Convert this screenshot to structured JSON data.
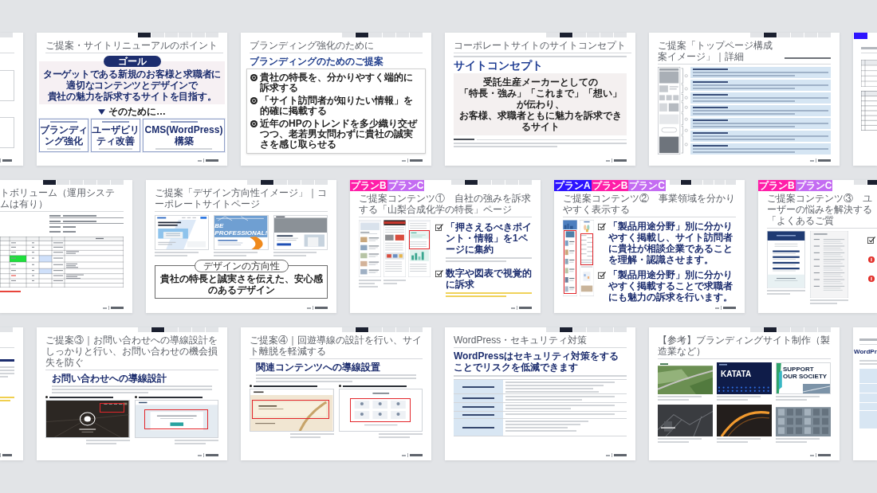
{
  "rows": [
    {
      "slides": [
        {
          "kind": "edge_outline",
          "nav_tabs": [
            {
              "selected": false
            }
          ]
        },
        {
          "kind": "goal",
          "nav_tabs": [
            {
              "selected": true
            },
            {
              "selected": false
            },
            {
              "selected": false
            },
            {
              "selected": false
            },
            {
              "selected": false
            },
            {
              "selected": false
            }
          ],
          "title": "ご提案・サイトリニューアルのポイント",
          "goal_label": "ゴール",
          "goal_lines": [
            "ターゲットである新規のお客様と求職者に",
            "適切なコンテンツとデザインで",
            "貴社の魅力を訴求するサイトを目指す。"
          ],
          "lead": "そのために…",
          "cards": [
            {
              "title": "ブランディング強化"
            },
            {
              "title": "ユーザビリティ改善"
            },
            {
              "title": "CMS(WordPress)構築"
            }
          ]
        },
        {
          "kind": "proposal_list",
          "nav_tabs": [
            {
              "selected": false
            },
            {
              "selected": true
            },
            {
              "selected": false
            },
            {
              "selected": false
            },
            {
              "selected": false
            },
            {
              "selected": false
            }
          ],
          "title": "ブランディング強化のために",
          "heading": "ブランディングのためのご提案",
          "items": [
            "貴社の特長を、分かりやすく端的に訴求する",
            "「サイト訪問者が知りたい情報」を的確に掲載する",
            "近年のHPのトレンドを多少織り交ぜつつ、老若男女問わずに貴社の誠実さを感じ取らせる"
          ]
        },
        {
          "kind": "concept",
          "nav_tabs": [
            {
              "selected": false
            },
            {
              "selected": true
            },
            {
              "selected": false
            },
            {
              "selected": false
            },
            {
              "selected": false
            },
            {
              "selected": false
            }
          ],
          "title": "コーポレートサイトのサイトコンセプト",
          "heading": "サイトコンセプト",
          "concept_lines": [
            "受託生産メーカーとしての",
            "「特長・強み」「これまで」「想い」が伝わり、",
            "お客様、求職者ともに魅力を訴求できるサイト"
          ]
        },
        {
          "kind": "wireframe",
          "nav_tabs": [
            {
              "selected": false
            },
            {
              "selected": true
            },
            {
              "selected": false
            },
            {
              "selected": false
            },
            {
              "selected": false
            },
            {
              "selected": false
            }
          ],
          "title": "ご提案「トップページ構成案イメージ」｜詳細"
        },
        {
          "kind": "edge_plan",
          "plan_tags": [
            {
              "color": "#2d14ff"
            }
          ]
        }
      ]
    },
    {
      "slides": [
        {
          "kind": "volume",
          "nav_tabs": [
            {
              "selected": true
            },
            {
              "selected": false
            },
            {
              "selected": false
            },
            {
              "selected": false
            },
            {
              "selected": false
            },
            {
              "selected": false
            }
          ],
          "title": "トボリューム（運用システムは有り）"
        },
        {
          "kind": "design_direction",
          "nav_tabs": [
            {
              "selected": false
            },
            {
              "selected": true
            },
            {
              "selected": false
            },
            {
              "selected": false
            },
            {
              "selected": false
            },
            {
              "selected": false
            }
          ],
          "title": "ご提案「デザイン方向性イメージ」｜コーポレートサイトページ",
          "references": [
            {
              "kind": "recycle"
            },
            {
              "kind": "professional",
              "headline": "BE PROFESSIONAL!"
            },
            {
              "kind": "portrait"
            }
          ],
          "direction_label": "デザインの方向性",
          "direction": "貴社の特長と誠実さを伝えた、安心感のあるデザイン"
        },
        {
          "kind": "feature_page",
          "plan_tags": [
            {
              "label": "プランB",
              "color": "#ff1ea8"
            },
            {
              "label": "プランC",
              "color": "#c46cf2"
            }
          ],
          "nav_tabs": [
            {
              "selected": false
            },
            {
              "selected": true
            },
            {
              "selected": false
            },
            {
              "selected": false
            },
            {
              "selected": false
            },
            {
              "selected": false
            }
          ],
          "title": "ご提案コンテンツ①　自社の強みを訴求する「山梨合成化学の特長」ページ",
          "checks": [
            {
              "heading": "「押さえるべきポイント・情報」を1ページに集約"
            },
            {
              "heading": "数字や図表で視覚的に訴求"
            }
          ]
        },
        {
          "kind": "business_fields",
          "plan_tags": [
            {
              "label": "プランA",
              "color": "#2d14ff"
            },
            {
              "label": "プランB",
              "color": "#ff1ea8"
            },
            {
              "label": "プランC",
              "color": "#c46cf2"
            }
          ],
          "nav_tabs": [
            {
              "selected": false
            },
            {
              "selected": true
            },
            {
              "selected": false
            },
            {
              "selected": false
            },
            {
              "selected": false
            },
            {
              "selected": false
            }
          ],
          "title": "ご提案コンテンツ②　事業領域を分かりやすく表示する",
          "checks": [
            {
              "heading": "「製品用途分野」別に分かりやすく掲載し、サイト訪問者に貴社が相談企業であることを理解・認識させます。"
            },
            {
              "heading": "「製品用途分野」別に分かりやすく掲載することで求職者にも魅力の訴求を行います。"
            }
          ]
        },
        {
          "kind": "faq_edge",
          "plan_tags": [
            {
              "label": "プランB",
              "color": "#ff1ea8"
            },
            {
              "label": "プランC",
              "color": "#c46cf2"
            }
          ],
          "nav_tabs": [
            {
              "selected": false
            },
            {
              "selected": true
            }
          ],
          "title": "ご提案コンテンツ③　ユーザーの悩みを解決する「よくあるご質"
        }
      ]
    },
    {
      "slides": [
        {
          "kind": "edge_notes",
          "nav_tabs": [
            {
              "selected": false
            }
          ]
        },
        {
          "kind": "contact",
          "nav_tabs": [
            {
              "selected": false
            },
            {
              "selected": true
            },
            {
              "selected": false
            },
            {
              "selected": false
            },
            {
              "selected": false
            },
            {
              "selected": false
            }
          ],
          "title": "ご提案③｜お問い合わせへの導線設計をしっかりと行い、お問い合わせの機会損失を防ぐ",
          "heading": "お問い合わせへの導線設計"
        },
        {
          "kind": "related",
          "nav_tabs": [
            {
              "selected": false
            },
            {
              "selected": true
            },
            {
              "selected": false
            },
            {
              "selected": false
            },
            {
              "selected": false
            },
            {
              "selected": false
            }
          ],
          "title": "ご提案④｜回遊導線の設計を行い、サイト離脱を軽減する",
          "heading": "関連コンテンツへの導線設置"
        },
        {
          "kind": "security",
          "nav_tabs": [
            {
              "selected": false
            },
            {
              "selected": true
            },
            {
              "selected": false
            },
            {
              "selected": false
            },
            {
              "selected": false
            },
            {
              "selected": false
            }
          ],
          "title": "WordPress・セキュリティ対策",
          "heading": "WordPressはセキュリティ対策をすることでリスクを低減できます"
        },
        {
          "kind": "references",
          "nav_tabs": [
            {
              "selected": false
            },
            {
              "selected": true
            },
            {
              "selected": false
            },
            {
              "selected": false
            },
            {
              "selected": false
            },
            {
              "selected": false
            }
          ],
          "title": "【参考】ブランディングサイト制作（製造業など）",
          "sites": [
            {
              "kind": "aerial"
            },
            {
              "kind": "katata",
              "headline": "KATATA"
            },
            {
              "kind": "society",
              "headline": "SUPPORT OUR SOCIETY"
            },
            {
              "kind": "mono"
            },
            {
              "kind": "orange_arc"
            },
            {
              "kind": "city"
            }
          ]
        },
        {
          "kind": "edge_security",
          "heading": "WordPr"
        }
      ]
    }
  ]
}
